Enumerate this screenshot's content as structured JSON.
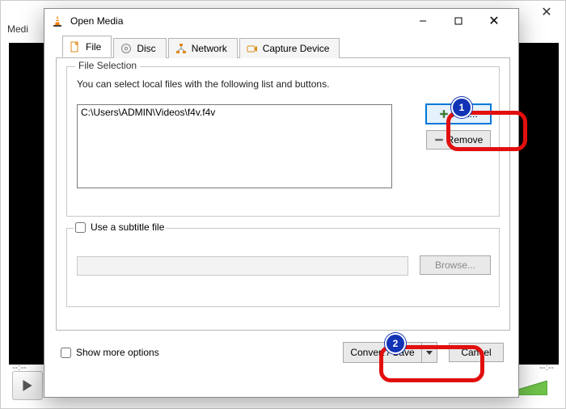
{
  "bg": {
    "menu_first": "Medi",
    "elapsed": "--:--",
    "remaining": "--:--"
  },
  "dialog": {
    "title": "Open Media",
    "tabs": {
      "file": "File",
      "disc": "Disc",
      "network": "Network",
      "capture": "Capture Device"
    },
    "file_selection": {
      "legend": "File Selection",
      "hint": "You can select local files with the following list and buttons.",
      "files": [
        "C:\\Users\\ADMIN\\Videos\\f4v.f4v"
      ],
      "add_label": "Add...",
      "remove_label": "Remove"
    },
    "subtitle": {
      "checkbox_label": "Use a subtitle file",
      "browse_label": "Browse..."
    },
    "show_more_label": "Show more options",
    "convert_label": "Convert / Save",
    "cancel_label": "Cancel"
  },
  "callouts": {
    "one": "1",
    "two": "2"
  }
}
